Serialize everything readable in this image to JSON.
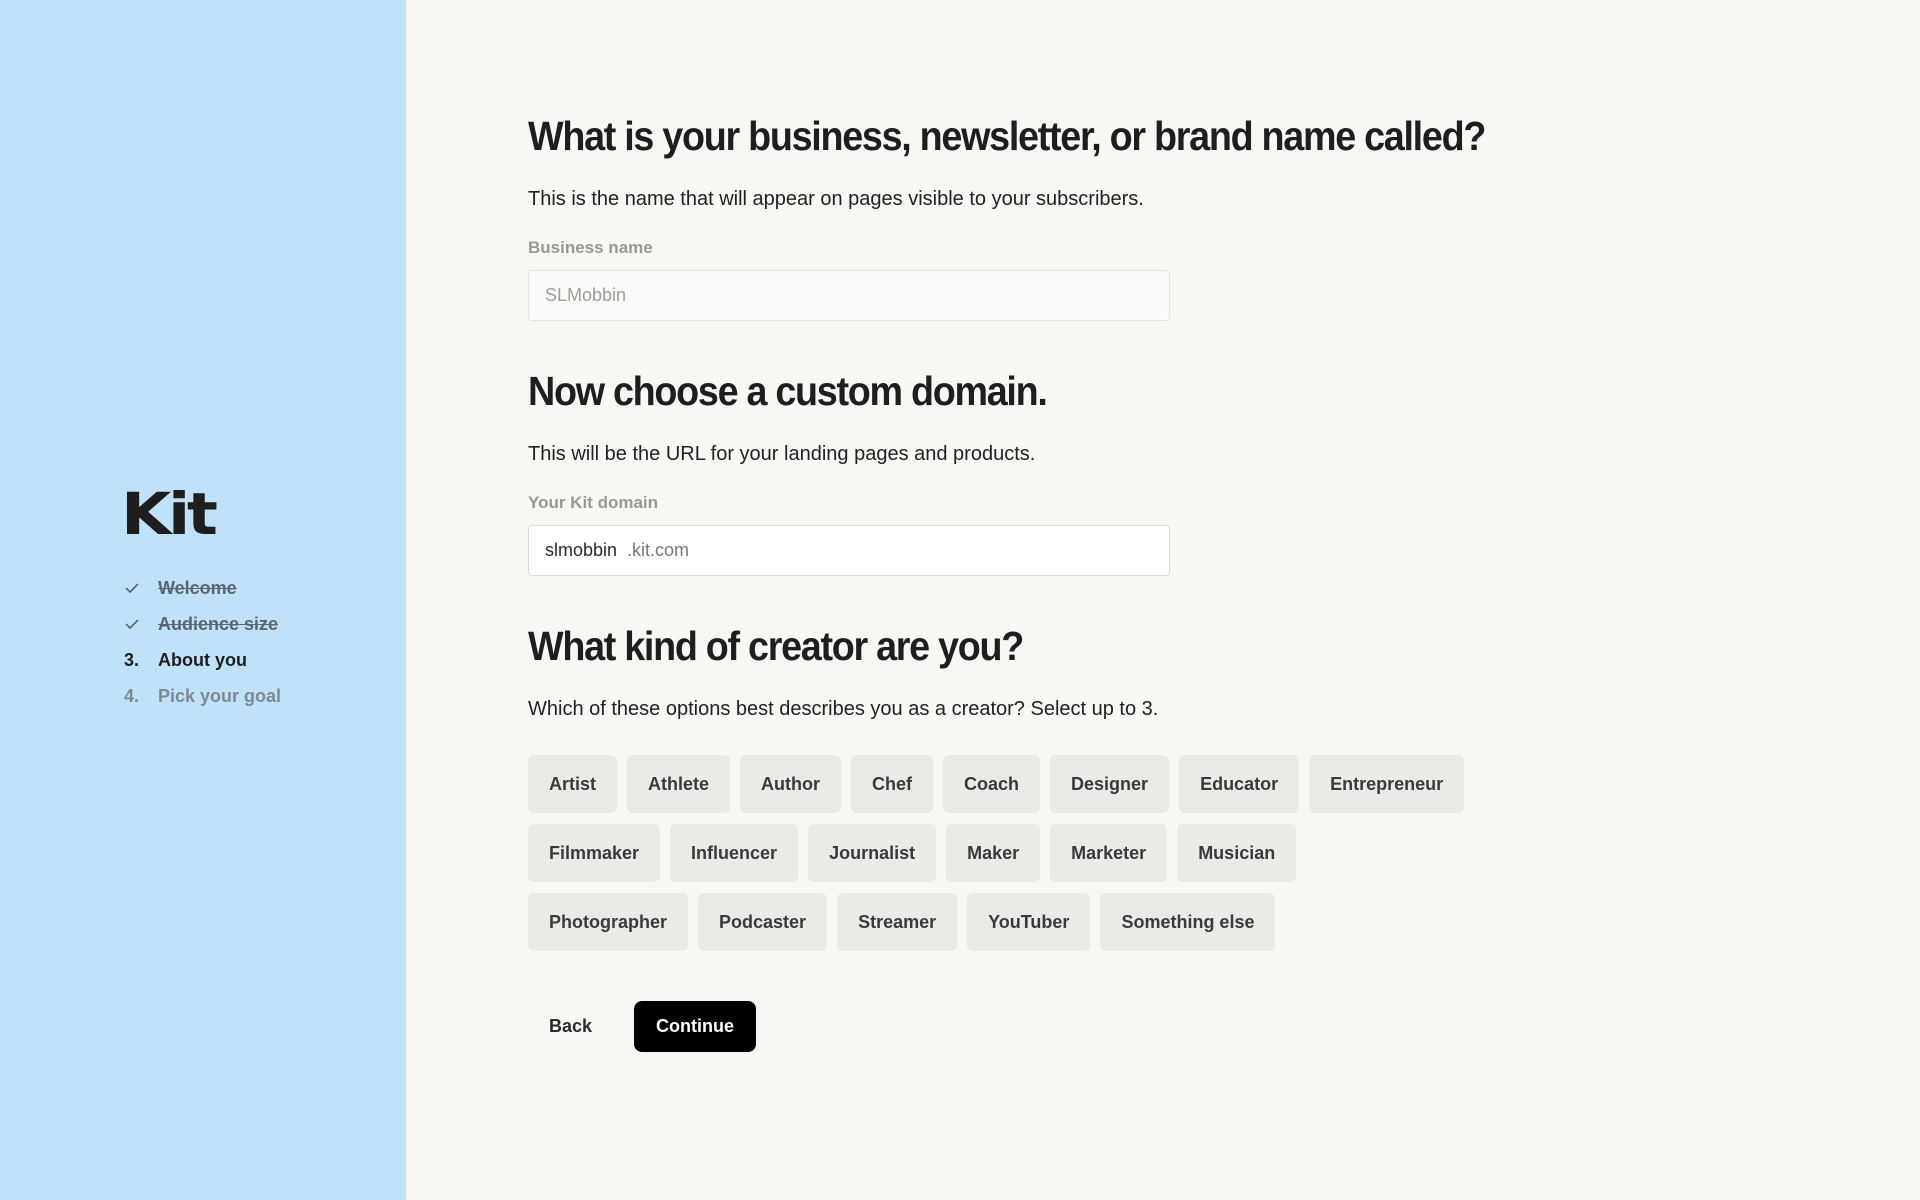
{
  "sidebar": {
    "logo": "Kit",
    "steps": [
      {
        "marker": "",
        "label": "Welcome",
        "state": "done"
      },
      {
        "marker": "",
        "label": "Audience size",
        "state": "done"
      },
      {
        "marker": "3.",
        "label": "About you",
        "state": "current"
      },
      {
        "marker": "4.",
        "label": "Pick your goal",
        "state": "todo"
      }
    ]
  },
  "business": {
    "heading": "What is your business, newsletter, or brand name called?",
    "description": "This is the name that will appear on pages visible to your subscribers.",
    "label": "Business name",
    "placeholder": "SLMobbin"
  },
  "domain": {
    "heading": "Now choose a custom domain.",
    "description": "This will be the URL for your landing pages and products.",
    "label": "Your Kit domain",
    "value": "slmobbin",
    "suffix": ".kit.com"
  },
  "creator": {
    "heading": "What kind of creator are you?",
    "description": "Which of these options best describes you as a creator? Select up to 3.",
    "rows": [
      [
        "Artist",
        "Athlete",
        "Author",
        "Chef",
        "Coach",
        "Designer",
        "Educator",
        "Entrepreneur"
      ],
      [
        "Filmmaker",
        "Influencer",
        "Journalist",
        "Maker",
        "Marketer",
        "Musician"
      ],
      [
        "Photographer",
        "Podcaster",
        "Streamer",
        "YouTuber",
        "Something else"
      ]
    ]
  },
  "actions": {
    "back": "Back",
    "continue": "Continue"
  },
  "colors": {
    "sidebar": "#bfe2f9",
    "background": "#f8f7f4",
    "chip": "#ebeae7",
    "primary_button": "#000000"
  }
}
